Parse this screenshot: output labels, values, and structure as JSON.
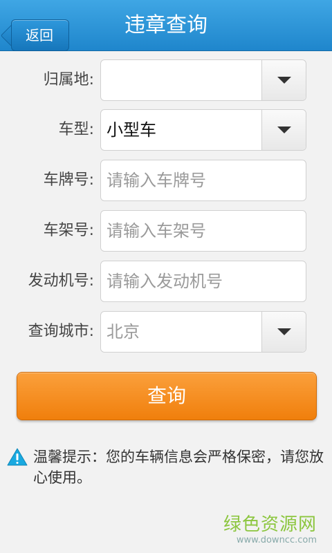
{
  "header": {
    "back_label": "返回",
    "title": "违章查询"
  },
  "form": {
    "region": {
      "label": "归属地:",
      "value": ""
    },
    "vehicle_type": {
      "label": "车型:",
      "value": "小型车"
    },
    "plate": {
      "label": "车牌号:",
      "placeholder": "请输入车牌号"
    },
    "frame": {
      "label": "车架号:",
      "placeholder": "请输入车架号"
    },
    "engine": {
      "label": "发动机号:",
      "placeholder": "请输入发动机号"
    },
    "city": {
      "label": "查询城市:",
      "value": "北京"
    }
  },
  "query_button": "查询",
  "tip": {
    "icon": "warning-triangle-icon",
    "text": "温馨提示：您的车辆信息会严格保密，请您放心使用。"
  },
  "watermark": {
    "name": "绿色资源网",
    "url": "www.downcc.com"
  },
  "colors": {
    "header": "#2a93d8",
    "button": "#f5901f",
    "watermark": "#8cc63f"
  }
}
